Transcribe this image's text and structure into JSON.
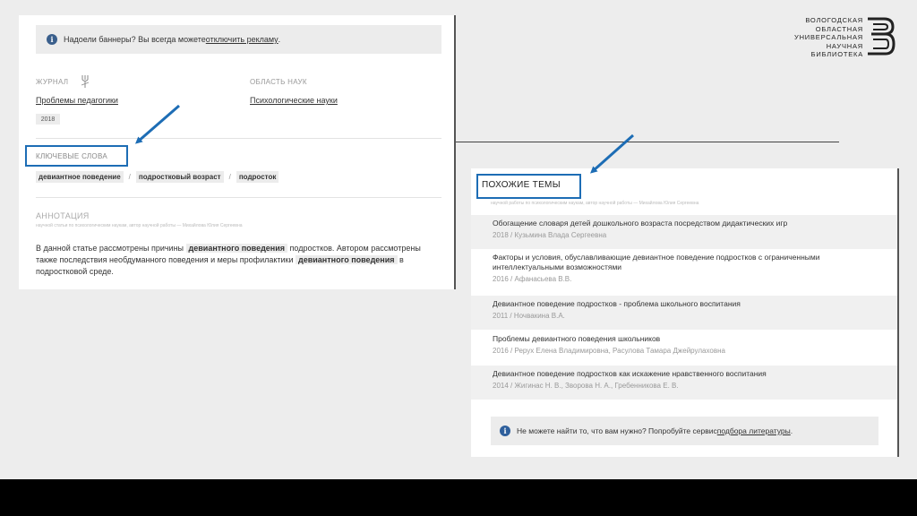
{
  "left_panel": {
    "banner": {
      "text": "Надоели баннеры? Вы всегда можете ",
      "link": "отключить рекламу",
      "end": "."
    },
    "journal_label": "ЖУРНАЛ",
    "journal_value": "Проблемы педагогики",
    "year": "2018",
    "area_label": "ОБЛАСТЬ НАУК",
    "area_value": "Психологические науки",
    "keywords_label": "КЛЮЧЕВЫЕ СЛОВА",
    "keywords": [
      "девиантное поведение",
      "подростковый возраст",
      "подросток"
    ],
    "keyword_separator": "/",
    "annotation_label": "АННОТАЦИЯ",
    "annotation_sub": "научной статьи по психологическим наукам, автор научной работы — Михайлова Юлия Сергеевна",
    "annotation": {
      "p1": "В данной статье рассмотрены причины ",
      "h1": "девиантного поведения",
      "p2": " подростков. Автором рассмотрены также последствия необдуманного поведения и меры профилактики ",
      "h2": "девиантного поведения",
      "p3": " в подростковой среде."
    }
  },
  "logo": {
    "lines": [
      "ВОЛОГОДСКАЯ",
      "ОБЛАСТНАЯ",
      "УНИВЕРСАЛЬНАЯ",
      "НАУЧНАЯ",
      "БИБЛИОТЕКА"
    ],
    "icon": "library-logo-icon"
  },
  "right_panel": {
    "label": "ПОХОЖИЕ ТЕМЫ",
    "sub": "научной работы по психологическим наукам, автор научной работы — Михайлова Юлия Сергеевна",
    "items": [
      {
        "title": "Обогащение словаря детей дошкольного возраста посредством дидактических игр",
        "meta": "2018 / Кузьмина Влада Сергеевна"
      },
      {
        "title": "Факторы и условия, обуславливающие девиантное поведение подростков с ограниченными интеллектуальными возможностями",
        "meta": "2016 / Афанасьева В.В."
      },
      {
        "title": "Девиантное поведение подростков - проблема школьного воспитания",
        "meta": "2011 / Ночвакина В.А."
      },
      {
        "title": "Проблемы девиантного поведения школьников",
        "meta": "2016 / Рерух Елена Владимировна, Расулова Тамара Джейрулаховна"
      },
      {
        "title": "Девиантное поведение подростков как искажение нравственного воспитания",
        "meta": "2014 / Жигинас Н. В., Зворова Н. А., Гребенникова Е. В."
      }
    ],
    "bottom_banner": {
      "text": "Не можете найти то, что вам нужно? Попробуйте сервис ",
      "link": "подбора литературы",
      "end": "."
    }
  },
  "colors": {
    "highlight_box": "#1d6db5",
    "info_icon": "#3a5f8c",
    "banner_bg": "#ececec"
  }
}
